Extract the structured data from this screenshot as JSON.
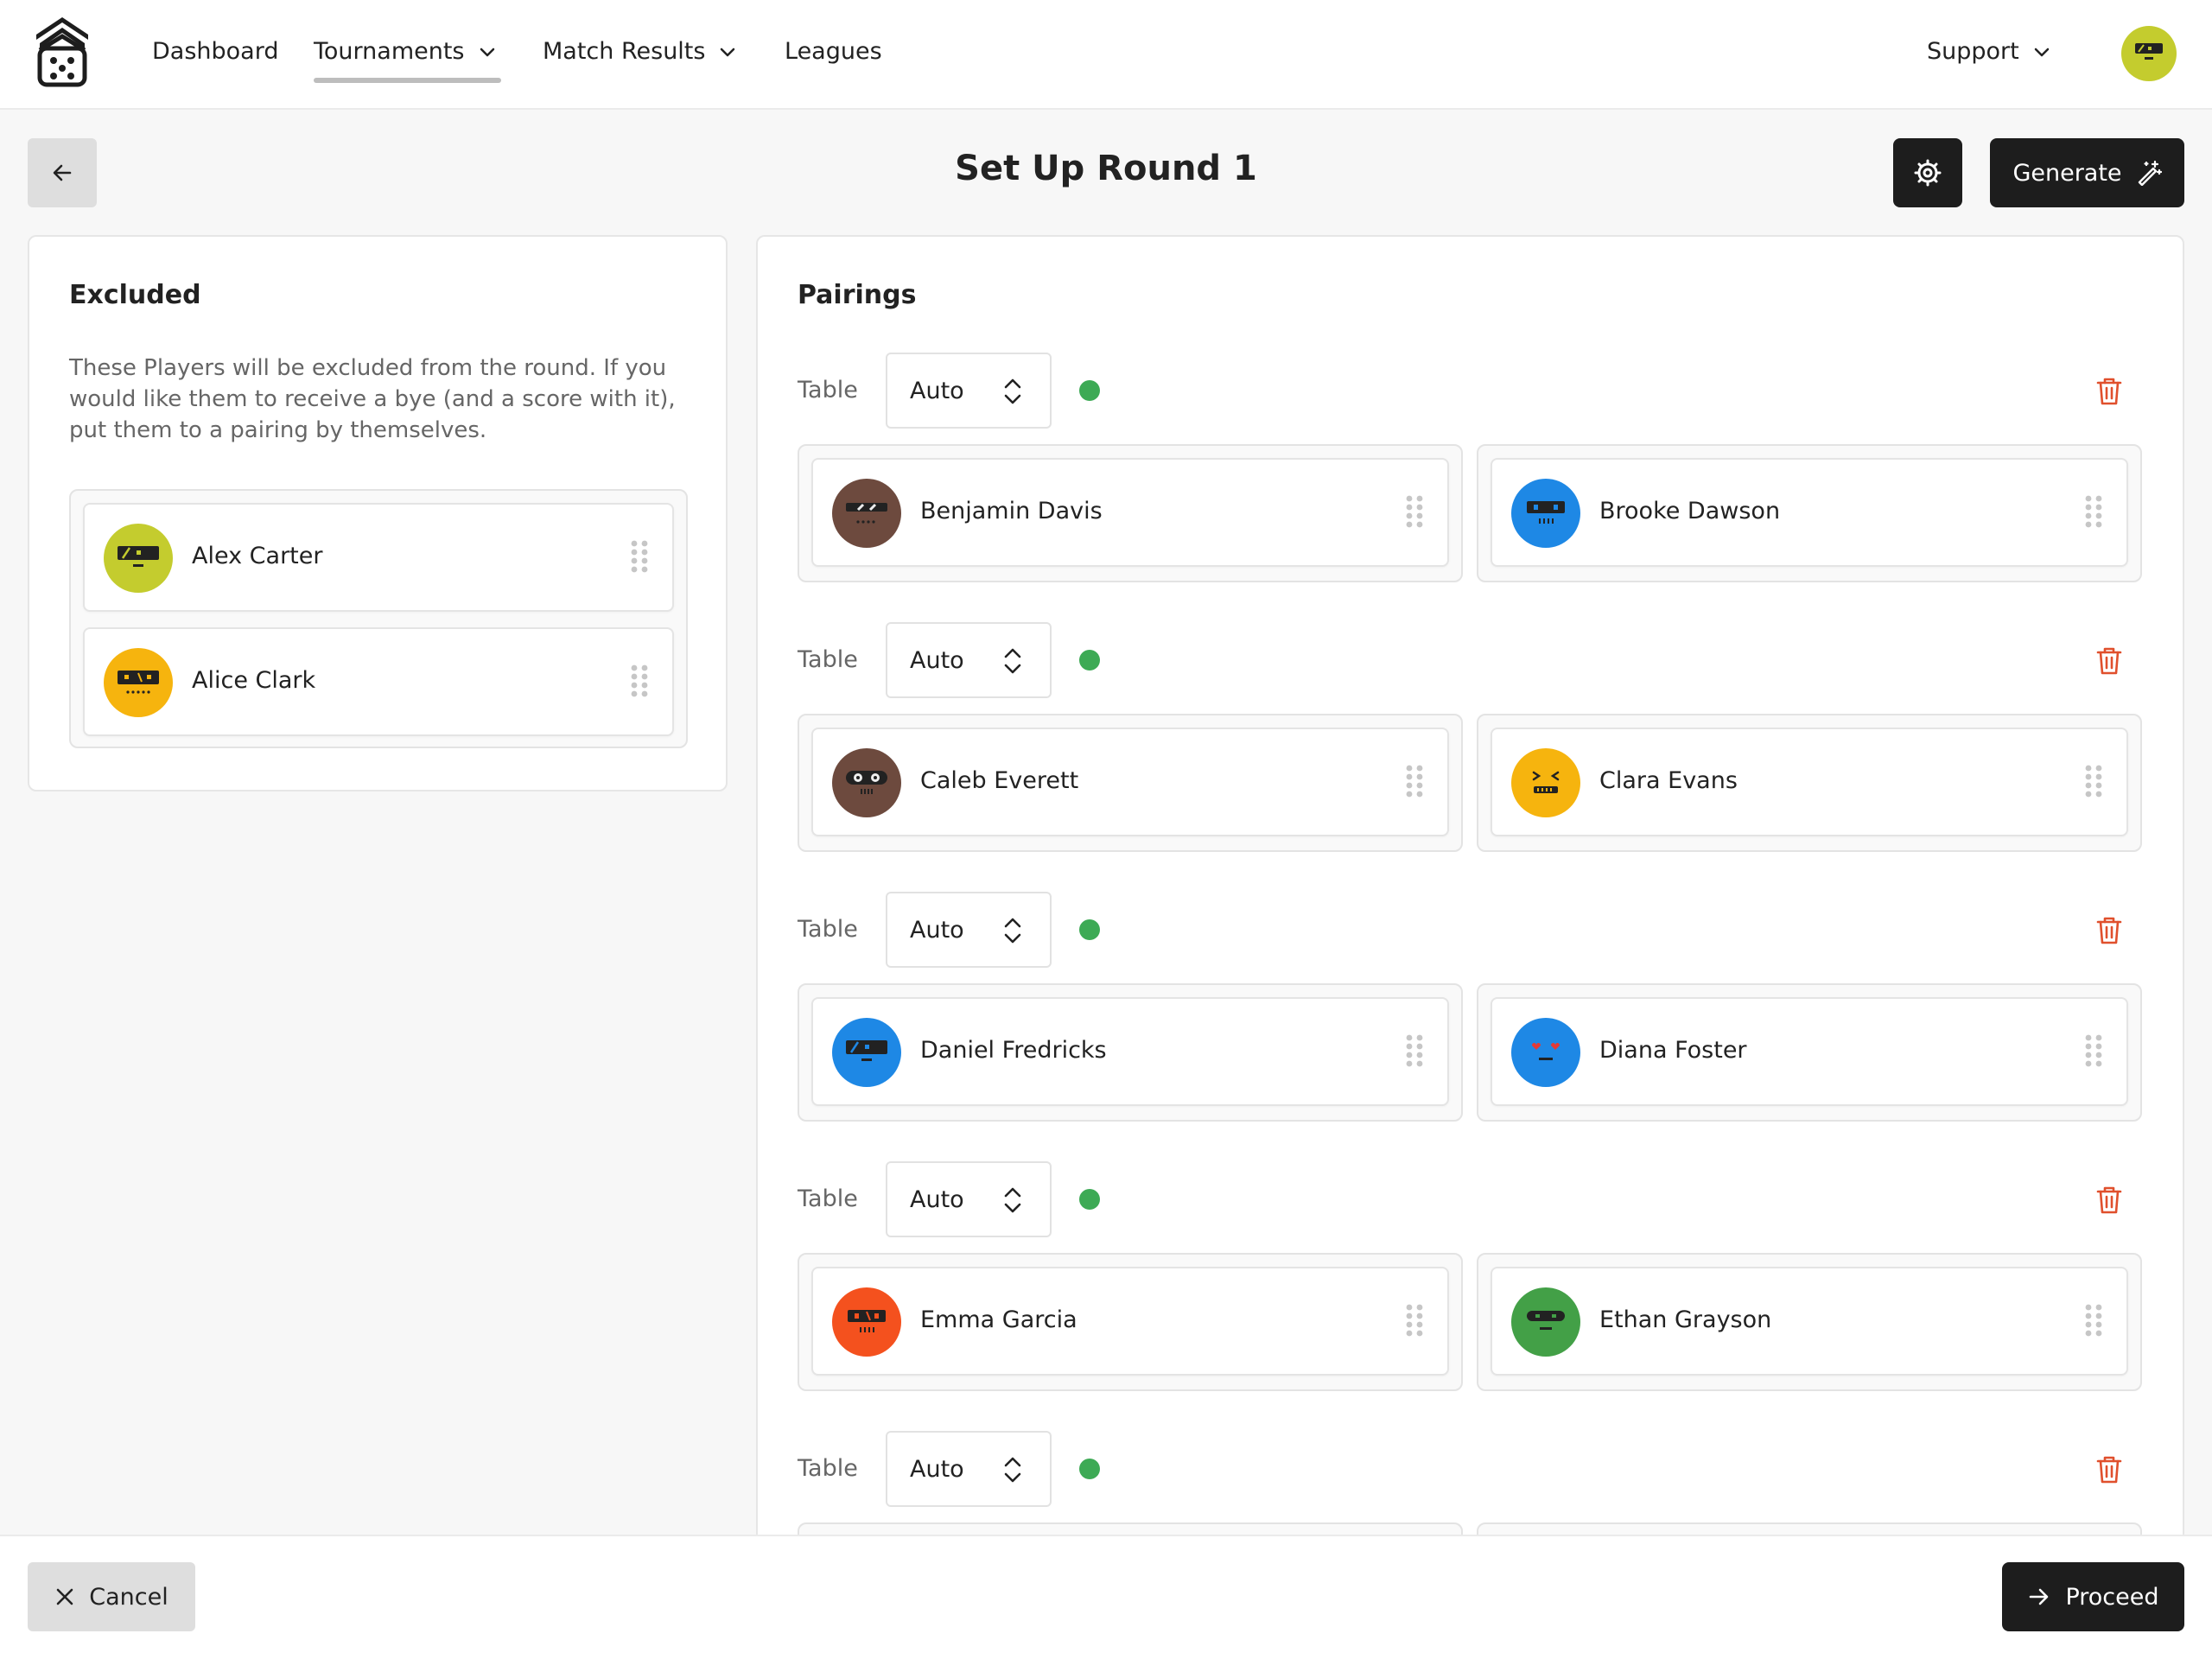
{
  "nav": {
    "items": [
      {
        "label": "Dashboard",
        "dropdown": false
      },
      {
        "label": "Tournaments",
        "dropdown": true,
        "active": true
      },
      {
        "label": "Match Results",
        "dropdown": true
      },
      {
        "label": "Leagues",
        "dropdown": false
      }
    ],
    "support_label": "Support"
  },
  "header": {
    "title": "Set Up Round 1",
    "generate_label": "Generate"
  },
  "excluded": {
    "title": "Excluded",
    "description": "These Players will be excluded from the round. If you would like them to receive a bye (and a score with it), put them to a pairing by themselves.",
    "players": [
      {
        "name": "Alex Carter",
        "color": "#c4cc2e",
        "icon": "robot-avatar"
      },
      {
        "name": "Alice Clark",
        "color": "#f6b40e",
        "icon": "robot-avatar"
      }
    ]
  },
  "pairings": {
    "title": "Pairings",
    "table_label": "Table",
    "rows": [
      {
        "table": "Auto",
        "players": [
          {
            "name": "Benjamin Davis",
            "color": "#6d4a3e"
          },
          {
            "name": "Brooke Dawson",
            "color": "#1e88e5"
          }
        ]
      },
      {
        "table": "Auto",
        "players": [
          {
            "name": "Caleb Everett",
            "color": "#6d4a3e"
          },
          {
            "name": "Clara Evans",
            "color": "#f6b40e"
          }
        ]
      },
      {
        "table": "Auto",
        "players": [
          {
            "name": "Daniel Fredricks",
            "color": "#1e88e5"
          },
          {
            "name": "Diana Foster",
            "color": "#1e88e5"
          }
        ]
      },
      {
        "table": "Auto",
        "players": [
          {
            "name": "Emma Garcia",
            "color": "#f4511e"
          },
          {
            "name": "Ethan Grayson",
            "color": "#43a047"
          }
        ]
      },
      {
        "table": "Auto",
        "players": []
      }
    ]
  },
  "footer": {
    "cancel_label": "Cancel",
    "proceed_label": "Proceed"
  },
  "colors": {
    "status_ok": "#3daa55",
    "delete": "#e0502d",
    "dark_button": "#1d1d1d"
  }
}
